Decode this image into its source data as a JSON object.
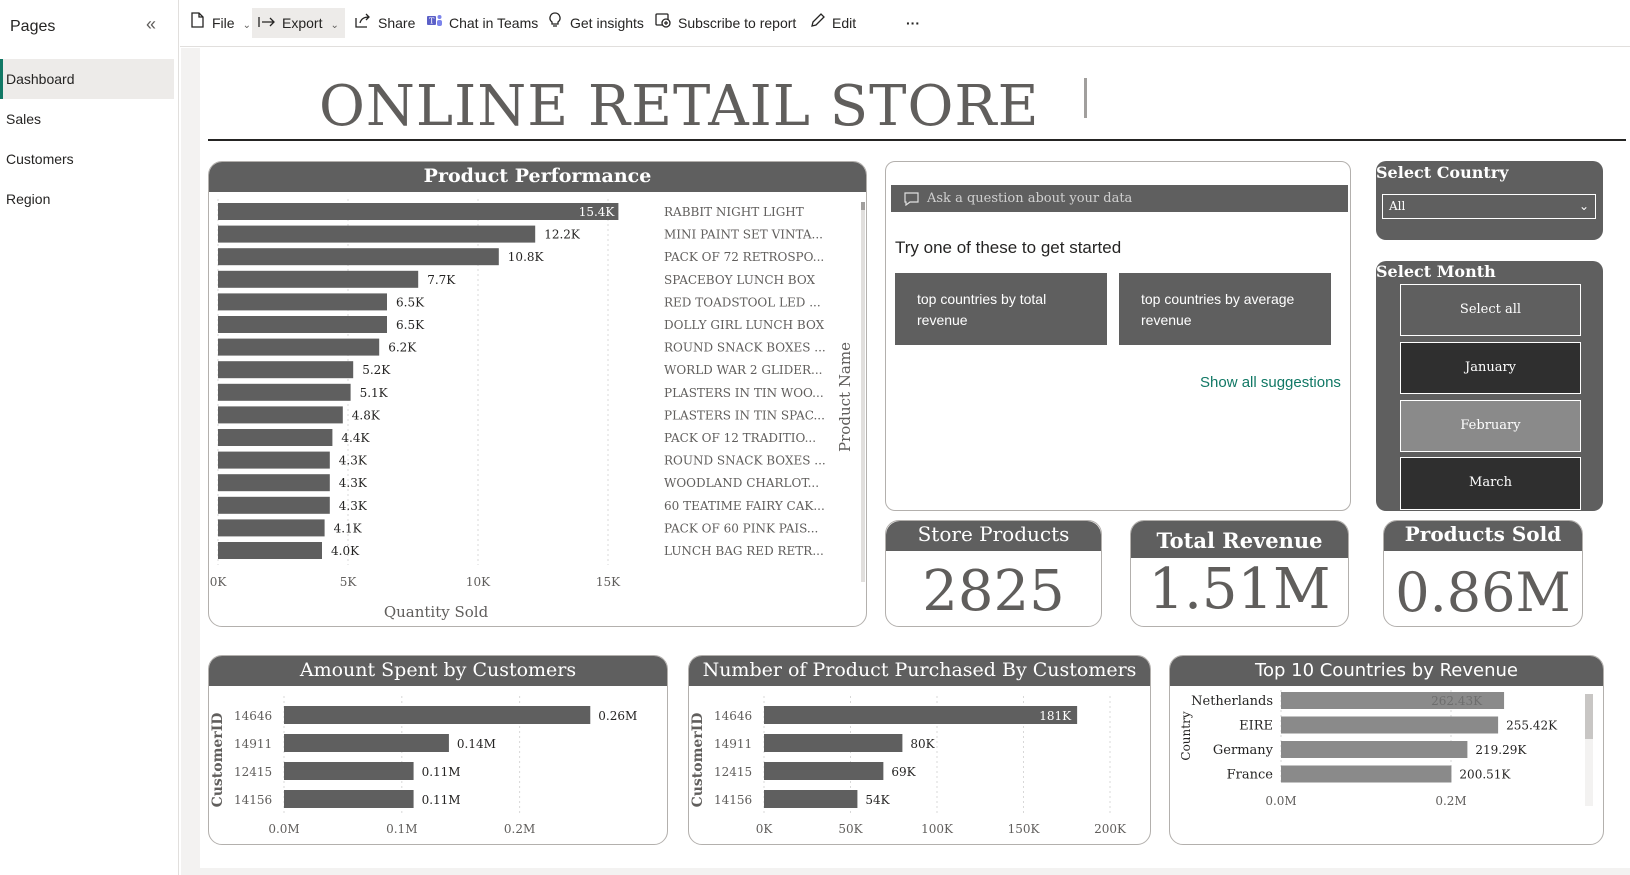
{
  "pages_pane": {
    "title": "Pages",
    "collapse_icon": "«",
    "items": [
      {
        "label": "Dashboard",
        "active": true
      },
      {
        "label": "Sales",
        "active": false
      },
      {
        "label": "Customers",
        "active": false
      },
      {
        "label": "Region",
        "active": false
      }
    ]
  },
  "toolbar": {
    "file": "File",
    "export": "Export",
    "share": "Share",
    "chat_in_teams": "Chat in Teams",
    "get_insights": "Get insights",
    "subscribe": "Subscribe to report",
    "edit": "Edit",
    "more": "···"
  },
  "report": {
    "title": "ONLINE RETAIL STORE"
  },
  "product_performance": {
    "title": "Product Performance",
    "xlabel": "Quantity Sold",
    "ylabel": "Product Name"
  },
  "qa": {
    "placeholder": "Ask a question about your data",
    "hint": "Try one of these to get started",
    "suggestion_1": "top countries by total revenue",
    "suggestion_2": "top countries by average revenue",
    "show_all": "Show all suggestions"
  },
  "country_slicer": {
    "title": "Select Country",
    "value": "All"
  },
  "month_slicer": {
    "title": "Select Month",
    "options": [
      {
        "label": "Select all"
      },
      {
        "label": "January"
      },
      {
        "label": "February"
      },
      {
        "label": "March"
      }
    ]
  },
  "kpis": {
    "store_products": {
      "label": "Store Products",
      "value": "2825"
    },
    "total_revenue": {
      "label": "Total Revenue",
      "value": "1.51M"
    },
    "products_sold": {
      "label": "Products Sold",
      "value": "0.86M"
    }
  },
  "amount_spent": {
    "title": "Amount Spent by Customers",
    "ylabel": "CustomerID"
  },
  "products_purchased": {
    "title": "Number of Product Purchased By Customers",
    "ylabel": "CustomerID"
  },
  "top_countries": {
    "title": "Top 10 Countries by Revenue",
    "ylabel": "Country"
  },
  "colors": {
    "bar": "#5f5f5f",
    "bar_light": "#8a8a8a",
    "accent": "#117865",
    "header": "#5f5f5f"
  },
  "chart_data": [
    {
      "id": "product_performance",
      "type": "bar",
      "orientation": "horizontal",
      "title": "Product Performance",
      "xlabel": "Quantity Sold",
      "ylabel": "Product Name",
      "categories": [
        "RABBIT NIGHT LIGHT",
        "MINI PAINT SET VINTA...",
        "PACK OF 72 RETROSPO...",
        "SPACEBOY LUNCH BOX",
        "RED TOADSTOOL LED ...",
        "DOLLY GIRL LUNCH BOX",
        "ROUND SNACK BOXES ...",
        "WORLD WAR 2 GLIDER...",
        "PLASTERS IN TIN WOO...",
        "PLASTERS IN TIN SPAC...",
        "PACK OF 12 TRADITIO...",
        "ROUND SNACK BOXES ...",
        "WOODLAND CHARLOT...",
        "60 TEATIME FAIRY CAK...",
        "PACK OF 60 PINK PAIS...",
        "LUNCH BAG RED RETR..."
      ],
      "values": [
        15400,
        12200,
        10800,
        7700,
        6500,
        6500,
        6200,
        5200,
        5100,
        4800,
        4400,
        4300,
        4300,
        4300,
        4100,
        4000
      ],
      "labels": [
        "15.4K",
        "12.2K",
        "10.8K",
        "7.7K",
        "6.5K",
        "6.5K",
        "6.2K",
        "5.2K",
        "5.1K",
        "4.8K",
        "4.4K",
        "4.3K",
        "4.3K",
        "4.3K",
        "4.1K",
        "4.0K"
      ],
      "xticks": [
        "0K",
        "5K",
        "10K",
        "15K"
      ],
      "xlim": [
        0,
        15000
      ]
    },
    {
      "id": "amount_spent",
      "type": "bar",
      "orientation": "horizontal",
      "title": "Amount Spent by Customers",
      "ylabel": "CustomerID",
      "categories": [
        "14646",
        "14911",
        "12415",
        "14156"
      ],
      "values": [
        0.26,
        0.14,
        0.11,
        0.11
      ],
      "labels": [
        "0.26M",
        "0.14M",
        "0.11M",
        "0.11M"
      ],
      "xticks": [
        "0.0M",
        "0.1M",
        "0.2M"
      ],
      "xlim": [
        0,
        0.2
      ]
    },
    {
      "id": "products_purchased",
      "type": "bar",
      "orientation": "horizontal",
      "title": "Number of Product Purchased By Customers",
      "ylabel": "CustomerID",
      "categories": [
        "14646",
        "14911",
        "12415",
        "14156"
      ],
      "values": [
        181000,
        80000,
        69000,
        54000
      ],
      "labels": [
        "181K",
        "80K",
        "69K",
        "54K"
      ],
      "xticks": [
        "0K",
        "50K",
        "100K",
        "150K",
        "200K"
      ],
      "xlim": [
        0,
        200000
      ]
    },
    {
      "id": "top_countries",
      "type": "bar",
      "orientation": "horizontal",
      "title": "Top 10 Countries by Revenue",
      "ylabel": "Country",
      "categories": [
        "Netherlands",
        "EIRE",
        "Germany",
        "France"
      ],
      "values": [
        262430,
        255420,
        219290,
        200510
      ],
      "labels": [
        "262.43K",
        "255.42K",
        "219.29K",
        "200.51K"
      ],
      "xticks": [
        "0.0M",
        "0.2M"
      ],
      "xlim": [
        0,
        200000
      ]
    }
  ]
}
